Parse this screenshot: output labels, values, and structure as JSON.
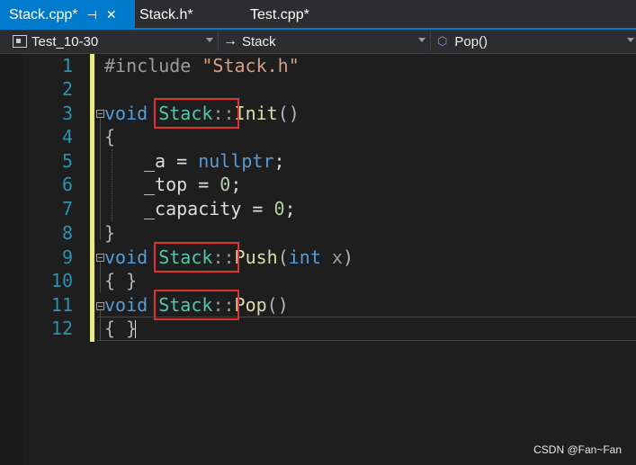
{
  "tabs": [
    {
      "label": "Stack.cpp*",
      "active": true,
      "pinned": true
    },
    {
      "label": "Stack.h*",
      "active": false
    },
    {
      "label": "Test.cpp*",
      "active": false
    }
  ],
  "navbar": {
    "project": "Test_10-30",
    "scope": "Stack",
    "member": "Pop()"
  },
  "icons": {
    "pin": "pin-icon",
    "close": "close-icon",
    "project": "project-icon",
    "scope_arrow": "arrow-icon",
    "member": "method-icon"
  },
  "code": {
    "line_numbers": [
      "1",
      "2",
      "3",
      "4",
      "5",
      "6",
      "7",
      "8",
      "9",
      "10",
      "11",
      "12"
    ],
    "line1": {
      "directive": "#include",
      "path": "\"Stack.h\""
    },
    "line3": {
      "kw": "void",
      "cls": "Stack",
      "sep": "::",
      "fn": "Init",
      "paren": "()"
    },
    "line4": {
      "brace": "{"
    },
    "line5": {
      "var": "_a",
      "op": " = ",
      "val": "nullptr",
      "semi": ";"
    },
    "line6": {
      "var": "_top",
      "op": " = ",
      "val": "0",
      "semi": ";"
    },
    "line7": {
      "var": "_capacity",
      "op": " = ",
      "val": "0",
      "semi": ";"
    },
    "line8": {
      "brace": "}"
    },
    "line9": {
      "kw": "void",
      "cls": "Stack",
      "sep": "::",
      "fn": "Push",
      "open": "(",
      "ptype": "int",
      "pname": " x",
      "close": ")"
    },
    "line10": {
      "body": "{ }"
    },
    "line11": {
      "kw": "void",
      "cls": "Stack",
      "sep": "::",
      "fn": "Pop",
      "paren": "()"
    },
    "line12": {
      "body": "{ }"
    }
  },
  "watermark": "CSDN @Fan~Fan",
  "colors": {
    "active_tab": "#007acc",
    "keyword": "#569cd6",
    "type": "#4ec9b0",
    "function": "#dcdcaa",
    "string": "#d69d85",
    "number": "#b5cea8",
    "line_number": "#2b91af",
    "highlight_box": "#e03131",
    "change_bar": "#eaea87"
  }
}
